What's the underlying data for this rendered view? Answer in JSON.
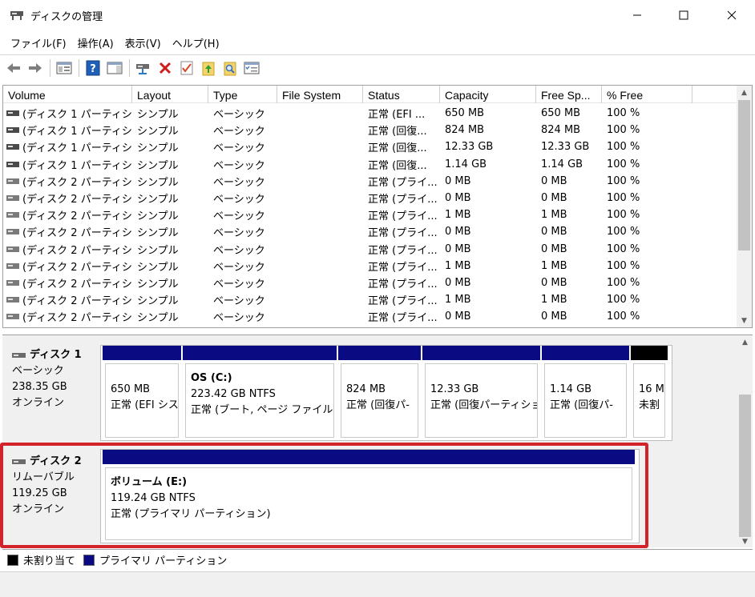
{
  "window": {
    "title": "ディスクの管理"
  },
  "menu": [
    "ファイル(F)",
    "操作(A)",
    "表示(V)",
    "ヘルプ(H)"
  ],
  "toolbar": {
    "icons": [
      "back-icon",
      "forward-icon",
      "disk-list-icon",
      "help-icon",
      "properties-panel-icon",
      "connect-drive-icon",
      "delete-icon",
      "checklist-icon",
      "folder-up-icon",
      "folder-search-icon",
      "settings-list-icon"
    ],
    "delete_color": "#d11c1c"
  },
  "volume_list": {
    "columns": [
      "Volume",
      "Layout",
      "Type",
      "File System",
      "Status",
      "Capacity",
      "Free Sp...",
      "% Free"
    ],
    "rows": [
      [
        "(ディスク 1 パーティショ...",
        "シンプル",
        "ベーシック",
        "",
        "正常 (EFI ...",
        "650 MB",
        "650 MB",
        "100 %"
      ],
      [
        "(ディスク 1 パーティショ...",
        "シンプル",
        "ベーシック",
        "",
        "正常 (回復...",
        "824 MB",
        "824 MB",
        "100 %"
      ],
      [
        "(ディスク 1 パーティショ...",
        "シンプル",
        "ベーシック",
        "",
        "正常 (回復...",
        "12.33 GB",
        "12.33 GB",
        "100 %"
      ],
      [
        "(ディスク 1 パーティショ...",
        "シンプル",
        "ベーシック",
        "",
        "正常 (回復...",
        "1.14 GB",
        "1.14 GB",
        "100 %"
      ],
      [
        "(ディスク 2 パーティショ...",
        "シンプル",
        "ベーシック",
        "",
        "正常 (プライ...",
        "0 MB",
        "0 MB",
        "100 %"
      ],
      [
        "(ディスク 2 パーティショ...",
        "シンプル",
        "ベーシック",
        "",
        "正常 (プライ...",
        "0 MB",
        "0 MB",
        "100 %"
      ],
      [
        "(ディスク 2 パーティショ...",
        "シンプル",
        "ベーシック",
        "",
        "正常 (プライ...",
        "1 MB",
        "1 MB",
        "100 %"
      ],
      [
        "(ディスク 2 パーティショ...",
        "シンプル",
        "ベーシック",
        "",
        "正常 (プライ...",
        "0 MB",
        "0 MB",
        "100 %"
      ],
      [
        "(ディスク 2 パーティショ...",
        "シンプル",
        "ベーシック",
        "",
        "正常 (プライ...",
        "0 MB",
        "0 MB",
        "100 %"
      ],
      [
        "(ディスク 2 パーティショ...",
        "シンプル",
        "ベーシック",
        "",
        "正常 (プライ...",
        "1 MB",
        "1 MB",
        "100 %"
      ],
      [
        "(ディスク 2 パーティショ...",
        "シンプル",
        "ベーシック",
        "",
        "正常 (プライ...",
        "0 MB",
        "0 MB",
        "100 %"
      ],
      [
        "(ディスク 2 パーティショ...",
        "シンプル",
        "ベーシック",
        "",
        "正常 (プライ...",
        "1 MB",
        "1 MB",
        "100 %"
      ],
      [
        "(ディスク 2 パーティショ...",
        "シンプル",
        "ベーシック",
        "",
        "正常 (プライ...",
        "0 MB",
        "0 MB",
        "100 %"
      ]
    ]
  },
  "disks": [
    {
      "name": "ディスク 1",
      "kind": "ベーシック",
      "size": "238.35 GB",
      "state": "オンライン",
      "partitions": [
        {
          "name": "",
          "size": "650 MB",
          "status": "正常 (EFI シス",
          "bar": "blue"
        },
        {
          "name": "OS  (C:)",
          "size": "223.42 GB NTFS",
          "status": "正常 (ブート, ページ ファイル, ク",
          "bar": "blue"
        },
        {
          "name": "",
          "size": "824 MB",
          "status": "正常 (回復パ-",
          "bar": "blue"
        },
        {
          "name": "",
          "size": "12.33 GB",
          "status": "正常 (回復パーティショ",
          "bar": "blue"
        },
        {
          "name": "",
          "size": "1.14 GB",
          "status": "正常 (回復パ-",
          "bar": "blue"
        },
        {
          "name": "",
          "size": "16 M",
          "status": "未割",
          "bar": "black"
        }
      ]
    },
    {
      "name": "ディスク 2",
      "kind": "リムーバブル",
      "size": "119.25 GB",
      "state": "オンライン",
      "partitions": [
        {
          "name": "ボリューム  (E:)",
          "size": "119.24 GB NTFS",
          "status": "正常 (プライマリ パーティション)",
          "bar": "blue"
        }
      ]
    }
  ],
  "legend": [
    {
      "label": "未割り当て",
      "color": "#000000"
    },
    {
      "label": "プライマリ パーティション",
      "color": "#0a0a82"
    }
  ],
  "highlight_color": "#d2232a"
}
